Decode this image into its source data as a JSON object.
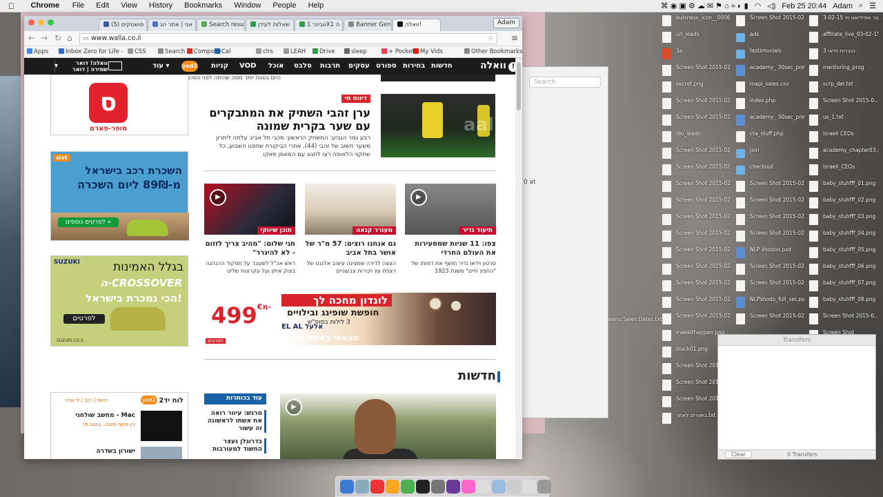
{
  "menubar": {
    "app": "Chrome",
    "menus": [
      "File",
      "Edit",
      "View",
      "History",
      "Bookmarks",
      "Window",
      "People",
      "Help"
    ],
    "clock": "Feb 25  20:44",
    "user": "Adam"
  },
  "browser": {
    "tabs": [
      {
        "label": "(5) פושטקים",
        "color": "#3b5998"
      },
      {
        "label": "אני | אתר הנ",
        "color": "#4a78c8"
      },
      {
        "label": "Search resul",
        "color": "#55aa55"
      },
      {
        "label": "שאלות לעידן",
        "color": "#2e9e4a"
      },
      {
        "label": "וובינר 1X1 ה",
        "color": "#2e9e4a"
      },
      {
        "label": "Banner Gene",
        "color": "#888888"
      },
      {
        "label": "וואלה!",
        "color": "#111111"
      }
    ],
    "user_chip": "Adam",
    "url": "www.walla.co.il",
    "bookmarks": [
      "Apps",
      "Inbox Zero for Life -",
      "CSS",
      "Search",
      "Compose",
      "Cal",
      "clrs",
      "LEAH",
      "Drive",
      "sleep",
      "+ Pocket",
      "My Vids",
      "Other Bookmarks"
    ]
  },
  "walla": {
    "logo": "וואלה",
    "nav": [
      "חדשות",
      "בחירות",
      "ספורט",
      "עסקים",
      "תרבות",
      "סלבס",
      "אוכל",
      "VOD",
      "קניות"
    ],
    "yad2": "yad2",
    "more": "עוד",
    "mail_line1": "וואלה! דואר",
    "mail_line2": "שמירה | דואר",
    "topline": "היום בטווח יותר ממה שהיתה לפני הסכם הגרעין",
    "hero": {
      "badge": "דיווח חי",
      "title": "ערן זהבי השתיק את המתבקרים עם שער בקרית שמונה",
      "text": "רבע גמר הגביע: המשחק הראשון: מכבי תל אביב עלתה ליתרון משער חשוב של זהבי (44), אחרי הביקורת שספגו השבוע, כל שחקני הלאופה רצו לחגוג עם המאמן פאקו"
    },
    "cards": [
      {
        "tag": "תיעוד נדיר",
        "title": "צפו: 11 שניות שמסעירות את העולם החרדי",
        "text": "סרטון וידאו נדיר חושף את דמותו של \"החפץ חיים\" משנת 1923",
        "video": true
      },
      {
        "tag": "מעורר קנאה",
        "title": "גם אנחנו רוצים: 57 מ\"ר של אושר בתל אביב",
        "text": "הצצה לדירה שמציגה עיצוב אלגנט של רצפת עץ וקירות צבעוניים",
        "video": false
      },
      {
        "tag": "תוכן שיווקי",
        "title": "חגי שלום: \"מהיב צריך לזזום - לא להיגרר\"",
        "text": "ראש אכ\"ל לשעבר על תפקוד ההנהגה בצוק איתן ועל עקרונות שליט",
        "video": true
      }
    ],
    "banner": {
      "headline": "לונדון מחכה לך",
      "sub": "חופשת שופינג ובילויים",
      "nights": "3 לילות בסופ\"ש",
      "airline": "EL AL אלעל",
      "price": "499",
      "currency": "€",
      "from": "מ-",
      "depart": "מצאתי באשת טורס",
      "more": "לפרטים"
    },
    "section_title": "חדשות",
    "headlines_header": "עוד בכותרות",
    "headlines": [
      "מרגש: עיוור רואה את אשתו לראשונה זה עשור",
      "בדרוגלן נעצר החשוד למעורבות"
    ],
    "ads": {
      "super_label": "סופר-פארם",
      "sixt_logo": "sixt",
      "sixt_line1": "השכרת רכב בישראל",
      "sixt_line2": "מ-89₪ ליום השכרה",
      "sixt_btn": "לפרטים נוספים »",
      "suzuki_logo": "SUZUKI",
      "suzuki_line1": "בגלל האמינות",
      "suzuki_line2": "ה-CROSSOVER",
      "suzuki_line3": "הכי נמכרת בישראל!",
      "suzuki_btn": "לפרטים",
      "suzuki_foot": "SUZUKI.CO.IL",
      "yad2_title": "לוח יד2",
      "yad2_links": "דירות | רכב | יד שניה",
      "yad2_items": [
        {
          "title": "מחשב שולחני - Mac",
          "sub": "בין פחות משנה, במצב מד"
        },
        {
          "title": "ישורון בשדרה",
          "sub": ""
        }
      ]
    }
  },
  "desktop": {
    "icons": [
      {
        "label": "buisness_icon__0006_Layer-1.png",
        "type": "file",
        "col": 0,
        "row": 0
      },
      {
        "label": "uri_leads",
        "type": "file",
        "col": 0,
        "row": 1
      },
      {
        "label": "3a",
        "type": "red",
        "col": 0,
        "row": 2
      },
      {
        "label": "Screen Shot 2015-02...8.53.37 AM",
        "type": "file",
        "col": 0,
        "row": 3
      },
      {
        "label": "secret.png",
        "type": "file",
        "col": 0,
        "row": 4
      },
      {
        "label": "Screen Shot 2015-02...1.46.05 PM",
        "type": "file",
        "col": 0,
        "row": 5
      },
      {
        "label": "Screen Shot 2015-02...1.49.51 PM",
        "type": "file",
        "col": 0,
        "row": 6
      },
      {
        "label": "ido_leads",
        "type": "file",
        "col": 0,
        "row": 7
      },
      {
        "label": "Screen Shot 2015-02...8.34.40 PM",
        "type": "file",
        "col": 0,
        "row": 8
      },
      {
        "label": "Screen Shot 2015-02...8.34.45 PM",
        "type": "file",
        "col": 0,
        "row": 9
      },
      {
        "label": "Screen Shot 2015-02...8.35.04 PM",
        "type": "file",
        "col": 0,
        "row": 10
      },
      {
        "label": "Screen Shot 2015-02...9.13.39 PM",
        "type": "file",
        "col": 0,
        "row": 11
      },
      {
        "label": "Screen Shot 2015-02...9.39.59 AM",
        "type": "file",
        "col": 0,
        "row": 12
      },
      {
        "label": "Screen Shot 2015-02...9.53.01 AM",
        "type": "file",
        "col": 0,
        "row": 13
      },
      {
        "label": "Screen Shot 2015-02...9.53.03 AM",
        "type": "file",
        "col": 0,
        "row": 14
      },
      {
        "label": "Screen Shot 2015-02...0.18.05 AM",
        "type": "file",
        "col": 0,
        "row": 15
      },
      {
        "label": "Screen Shot 2015-02...1.19.05 AM",
        "type": "file",
        "col": 0,
        "row": 16
      },
      {
        "label": "Screen Shot 2015-02...9.52.39 PM",
        "type": "file",
        "col": 0,
        "row": 17
      },
      {
        "label": "Screen Shot 2015-02...1.01.50 PM",
        "type": "file",
        "col": 0,
        "row": 18
      },
      {
        "label": "makeithappen.png",
        "type": "file",
        "col": 0,
        "row": 19
      },
      {
        "label": "black01.png",
        "type": "file",
        "col": 0,
        "row": 20
      },
      {
        "label": "Screen Shot 2015-02...0.42.1",
        "type": "file",
        "col": 0,
        "row": 21
      },
      {
        "label": "Screen Shot 2015-02...0.44.2",
        "type": "file",
        "col": 0,
        "row": 22
      },
      {
        "label": "Screen Shot 2015-02...0.45.1",
        "type": "file",
        "col": 0,
        "row": 23
      },
      {
        "label": "ביאורים לאתר.txt",
        "type": "file",
        "col": 0,
        "row": 24
      },
      {
        "label": "Screen Shot 2015-02...1.44.24 PM",
        "type": "file",
        "col": 1,
        "row": 0
      },
      {
        "label": "ads",
        "type": "folder",
        "col": 1,
        "row": 1
      },
      {
        "label": "testimonials",
        "type": "folder",
        "col": 1,
        "row": 2
      },
      {
        "label": "academy_ 30sec_preview",
        "type": "blue",
        "col": 1,
        "row": 3
      },
      {
        "label": "mapi_sales.csv",
        "type": "file",
        "col": 1,
        "row": 4
      },
      {
        "label": "index.php",
        "type": "file",
        "col": 1,
        "row": 5
      },
      {
        "label": "academy_ 30sec_preview.mov",
        "type": "blue",
        "col": 1,
        "row": 6
      },
      {
        "label": "cta_stuff.php",
        "type": "file",
        "col": 1,
        "row": 7
      },
      {
        "label": "join",
        "type": "folder",
        "col": 1,
        "row": 8
      },
      {
        "label": "checkout",
        "type": "folder",
        "col": 1,
        "row": 9
      },
      {
        "label": "Screen Shot 2015-02...7.32.00 PM",
        "type": "file",
        "col": 1,
        "row": 10
      },
      {
        "label": "Screen Shot 2015-02...7.33.51 PM",
        "type": "file",
        "col": 1,
        "row": 11
      },
      {
        "label": "Screen Shot 2015-02...7.37.20 PM",
        "type": "file",
        "col": 1,
        "row": 12
      },
      {
        "label": "Screen Shot 2015-02...8.32.41 PM",
        "type": "file",
        "col": 1,
        "row": 13
      },
      {
        "label": "NLP Voodoo.psd",
        "type": "blue",
        "col": 1,
        "row": 14
      },
      {
        "label": "Screen Shot 2015-02...8.33.11 PM",
        "type": "file",
        "col": 1,
        "row": 15
      },
      {
        "label": "Screen Shot 2015-02...8.38.25 PM",
        "type": "file",
        "col": 1,
        "row": 16
      },
      {
        "label": "NLPVoodo_full_set.psd",
        "type": "blue",
        "col": 1,
        "row": 17
      },
      {
        "label": "Screen Shot 2015-02...8.38.32 PM",
        "type": "file",
        "col": 1,
        "row": 18
      },
      {
        "label": "שיעור אפילייאט חי 3-02-15",
        "type": "file",
        "col": 2,
        "row": 0
      },
      {
        "label": "affiliate_live_03-02-15",
        "type": "file",
        "col": 2,
        "row": 1
      },
      {
        "label": "הוברות וידאו 3",
        "type": "file",
        "col": 2,
        "row": 2
      },
      {
        "label": "mentoring_prog",
        "type": "file",
        "col": 2,
        "row": 3
      },
      {
        "label": "scrp_del.txt",
        "type": "file",
        "col": 2,
        "row": 4
      },
      {
        "label": "Screen Shot 2015-0...6.34.34 PM",
        "type": "file",
        "col": 2,
        "row": 5
      },
      {
        "label": "us_1.txt",
        "type": "file",
        "col": 2,
        "row": 6
      },
      {
        "label": "Israeli CEOs",
        "type": "file",
        "col": 2,
        "row": 7
      },
      {
        "label": "academy_chapter03.pdf",
        "type": "file",
        "col": 2,
        "row": 8
      },
      {
        "label": "Israeli_CEOs",
        "type": "file",
        "col": 2,
        "row": 9
      },
      {
        "label": "baby_stuhfff_01.png",
        "type": "file",
        "col": 2,
        "row": 10
      },
      {
        "label": "baby_stuhfff_02.png",
        "type": "file",
        "col": 2,
        "row": 11
      },
      {
        "label": "baby_stuhfff_03.png",
        "type": "file",
        "col": 2,
        "row": 12
      },
      {
        "label": "baby_stuhfff_04.png",
        "type": "file",
        "col": 2,
        "row": 13
      },
      {
        "label": "baby_stuhfff_05.png",
        "type": "file",
        "col": 2,
        "row": 14
      },
      {
        "label": "baby_stuhfff_06.png",
        "type": "file",
        "col": 2,
        "row": 15
      },
      {
        "label": "baby_stuhfff_07.png",
        "type": "file",
        "col": 2,
        "row": 16
      },
      {
        "label": "baby_stuhfff_08.png",
        "type": "file",
        "col": 2,
        "row": 17
      },
      {
        "label": "Screen Shot 2015-0...2.52.49 PM",
        "type": "file",
        "col": 2,
        "row": 18
      },
      {
        "label": "Screen Shot",
        "type": "file",
        "col": 2,
        "row": 19
      }
    ]
  },
  "finder": {
    "search_placeholder": "Search",
    "text": "0 at"
  },
  "transfers": {
    "title": "Transfers",
    "clear": "Clear",
    "count": "0 Transfers"
  },
  "desktop_partial_label": "eanu Sales Dates.txt"
}
